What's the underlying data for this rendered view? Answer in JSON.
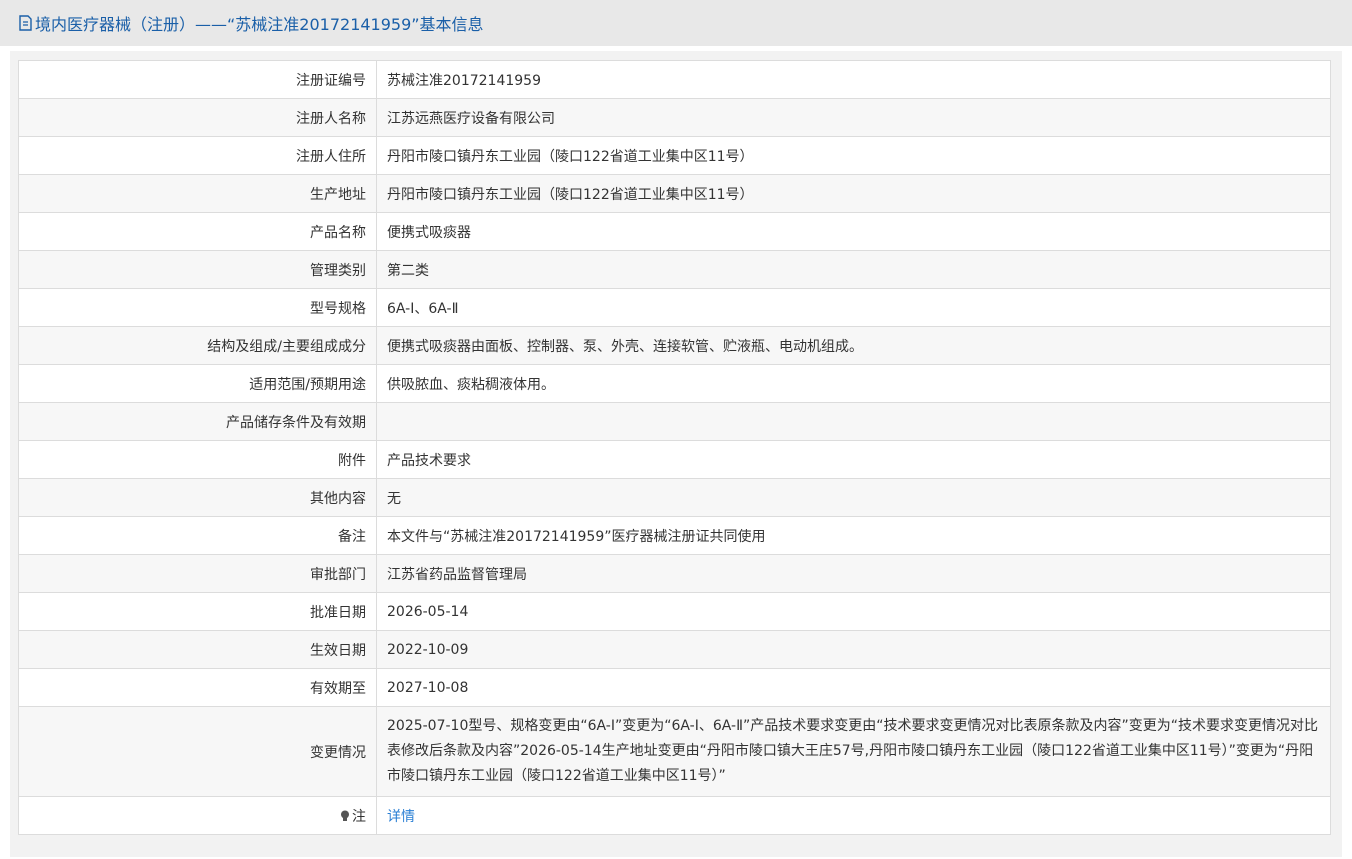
{
  "header": {
    "title": "境内医疗器械（注册）——“苏械注准20172141959”基本信息"
  },
  "rows": [
    {
      "label": "注册证编号",
      "value": "苏械注准20172141959"
    },
    {
      "label": "注册人名称",
      "value": "江苏远燕医疗设备有限公司"
    },
    {
      "label": "注册人住所",
      "value": "丹阳市陵口镇丹东工业园（陵口122省道工业集中区11号）"
    },
    {
      "label": "生产地址",
      "value": "丹阳市陵口镇丹东工业园（陵口122省道工业集中区11号）"
    },
    {
      "label": "产品名称",
      "value": "便携式吸痰器"
    },
    {
      "label": "管理类别",
      "value": "第二类"
    },
    {
      "label": "型号规格",
      "value": "6A-Ⅰ、6A-Ⅱ"
    },
    {
      "label": "结构及组成/主要组成成分",
      "value": "便携式吸痰器由面板、控制器、泵、外壳、连接软管、贮液瓶、电动机组成。"
    },
    {
      "label": "适用范围/预期用途",
      "value": "供吸脓血、痰粘稠液体用。"
    },
    {
      "label": "产品储存条件及有效期",
      "value": ""
    },
    {
      "label": "附件",
      "value": "产品技术要求"
    },
    {
      "label": "其他内容",
      "value": "无"
    },
    {
      "label": "备注",
      "value": "本文件与“苏械注准20172141959”医疗器械注册证共同使用"
    },
    {
      "label": "审批部门",
      "value": "江苏省药品监督管理局"
    },
    {
      "label": "批准日期",
      "value": "2026-05-14"
    },
    {
      "label": "生效日期",
      "value": "2022-10-09"
    },
    {
      "label": "有效期至",
      "value": "2027-10-08"
    },
    {
      "label": "变更情况",
      "value": "2025-07-10型号、规格变更由“6A-Ⅰ”变更为“6A-Ⅰ、6A-Ⅱ”产品技术要求变更由“技术要求变更情况对比表原条款及内容”变更为“技术要求变更情况对比表修改后条款及内容”2026-05-14生产地址变更由“丹阳市陵口镇大王庄57号,丹阳市陵口镇丹东工业园（陵口122省道工业集中区11号）”变更为“丹阳市陵口镇丹东工业园（陵口122省道工业集中区11号）”"
    }
  ],
  "note": {
    "label": "注",
    "link_text": "详情",
    "icon": "lightbulb-icon"
  },
  "colors": {
    "header_bg": "#e8e8e8",
    "title": "#1a5fa8",
    "link": "#2a7fd4",
    "alt_row": "#f7f7f7"
  }
}
